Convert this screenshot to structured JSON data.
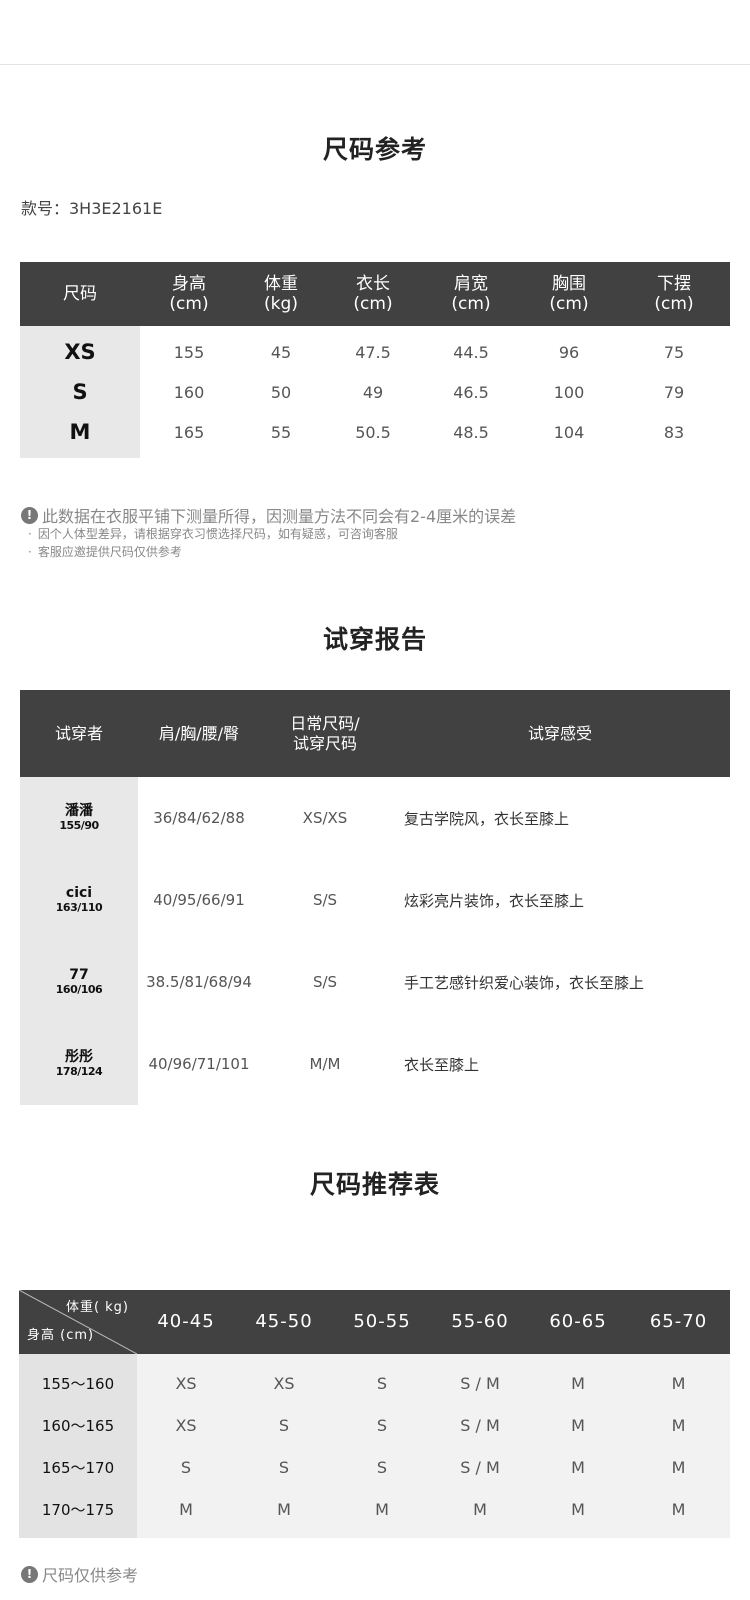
{
  "size_reference": {
    "title": "尺码参考",
    "style_number": "款号：3H3E2161E",
    "headers": [
      {
        "line1": "尺码",
        "line2": ""
      },
      {
        "line1": "身高",
        "line2": "(cm)"
      },
      {
        "line1": "体重",
        "line2": "(kg)"
      },
      {
        "line1": "衣长",
        "line2": "(cm)"
      },
      {
        "line1": "肩宽",
        "line2": "(cm)"
      },
      {
        "line1": "胸围",
        "line2": "(cm)"
      },
      {
        "line1": "下摆",
        "line2": "(cm)"
      }
    ],
    "rows": [
      {
        "size": "XS",
        "values": [
          "155",
          "45",
          "47.5",
          "44.5",
          "96",
          "75"
        ]
      },
      {
        "size": "S",
        "values": [
          "160",
          "50",
          "49",
          "46.5",
          "100",
          "79"
        ]
      },
      {
        "size": "M",
        "values": [
          "165",
          "55",
          "50.5",
          "48.5",
          "104",
          "83"
        ]
      }
    ],
    "note_icon": "!",
    "note_main": "此数据在衣服平铺下测量所得，因测量方法不同会有2-4厘米的误差",
    "note_sub": [
      "因个人体型差异，请根据穿衣习惯选择尺码，如有疑惑，可咨询客服",
      "客服应邀提供尺码仅供参考"
    ]
  },
  "fit_report": {
    "title": "试穿报告",
    "headers": [
      {
        "line1": "试穿者",
        "line2": ""
      },
      {
        "line1": "肩/胸/腰/臀",
        "line2": ""
      },
      {
        "line1": "日常尺码/",
        "line2": "试穿尺码"
      },
      {
        "line1": "试穿感受",
        "line2": ""
      }
    ],
    "rows": [
      {
        "name": "潘潘",
        "height_weight": "155/90",
        "measurements": "36/84/62/88",
        "sizes": "XS/XS",
        "feeling": "复古学院风，衣长至膝上"
      },
      {
        "name": "cici",
        "height_weight": "163/110",
        "measurements": "40/95/66/91",
        "sizes": "S/S",
        "feeling": "炫彩亮片装饰，衣长至膝上"
      },
      {
        "name": "77",
        "height_weight": "160/106",
        "measurements": "38.5/81/68/94",
        "sizes": "S/S",
        "feeling": "手工艺感针织爱心装饰，衣长至膝上"
      },
      {
        "name": "彤彤",
        "height_weight": "178/124",
        "measurements": "40/96/71/101",
        "sizes": "M/M",
        "feeling": "衣长至膝上"
      }
    ]
  },
  "recommendation": {
    "title": "尺码推荐表",
    "corner_top": "体重( kg)",
    "corner_bottom": "身高 (cm)",
    "weights": [
      "40-45",
      "45-50",
      "50-55",
      "55-60",
      "60-65",
      "65-70"
    ],
    "rows": [
      {
        "height": "155～160",
        "sizes": [
          "XS",
          "XS",
          "S",
          "S / M",
          "M",
          "M"
        ]
      },
      {
        "height": "160～165",
        "sizes": [
          "XS",
          "S",
          "S",
          "S / M",
          "M",
          "M"
        ]
      },
      {
        "height": "165～170",
        "sizes": [
          "S",
          "S",
          "S",
          "S / M",
          "M",
          "M"
        ]
      },
      {
        "height": "170～175",
        "sizes": [
          "M",
          "M",
          "M",
          "M",
          "M",
          "M"
        ]
      }
    ],
    "footnote": "尺码仅供参考"
  },
  "colors": {
    "header_bg": "#414141",
    "rowhead_bg": "#e8e8e8",
    "note_text": "#888888"
  }
}
